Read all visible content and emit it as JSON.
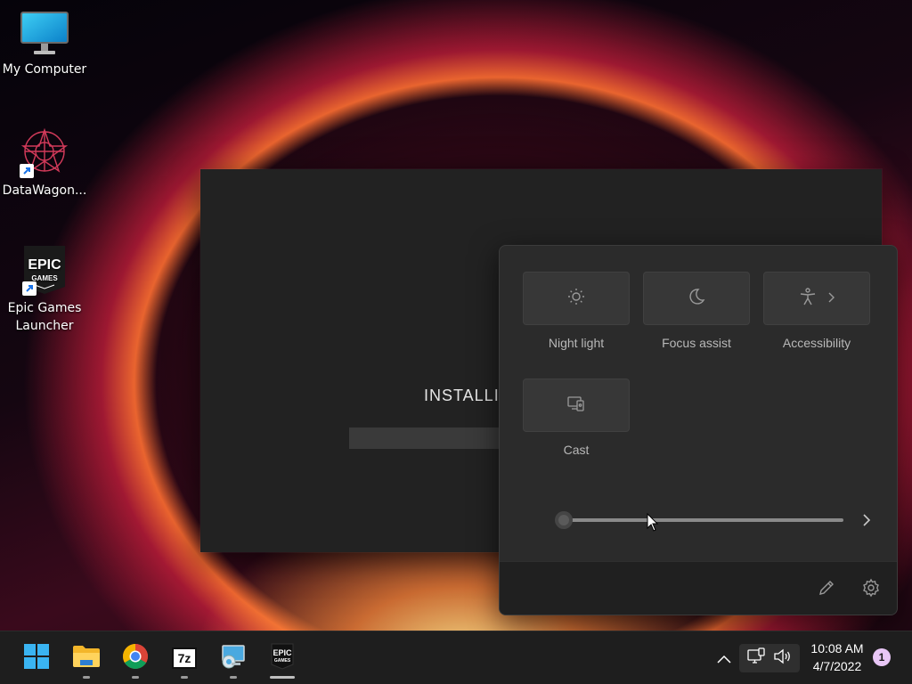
{
  "desktop": {
    "icons": [
      {
        "label": "My Computer",
        "icon": "monitor-icon"
      },
      {
        "label": "DataWagon...",
        "icon": "datawagon-logo-icon"
      },
      {
        "label": "Epic Games Launcher",
        "icon": "epic-games-logo-icon",
        "logo_text": [
          "EPIC",
          "GAMES"
        ]
      }
    ]
  },
  "installer": {
    "status_text": "INSTALLI"
  },
  "quick_settings": {
    "tiles": [
      {
        "label": "Night light",
        "icon": "night-light-icon"
      },
      {
        "label": "Focus assist",
        "icon": "moon-icon"
      },
      {
        "label": "Accessibility",
        "icon": "accessibility-icon",
        "has_chevron": true
      },
      {
        "label": "Cast",
        "icon": "cast-icon"
      }
    ],
    "slider": {
      "level": 0
    },
    "footer": {
      "edit_icon": "pencil-icon",
      "settings_icon": "gear-icon"
    }
  },
  "taskbar": {
    "apps": [
      {
        "name": "start",
        "icon": "windows-logo-icon"
      },
      {
        "name": "file-explorer",
        "icon": "folder-icon"
      },
      {
        "name": "chrome",
        "icon": "chrome-icon"
      },
      {
        "name": "7zip",
        "icon": "7zip-icon",
        "text": "7z"
      },
      {
        "name": "control-panel",
        "icon": "control-panel-icon"
      },
      {
        "name": "epic-games",
        "icon": "epic-games-logo-icon",
        "text": [
          "EPIC",
          "GAMES"
        ]
      }
    ],
    "clock": {
      "time": "10:08 AM",
      "date": "4/7/2022"
    },
    "notification_count": "1"
  },
  "colors": {
    "flyout_bg": "#2b2b2b",
    "taskbar_bg": "#1e1e1e",
    "badge": "#e8c6f5"
  }
}
